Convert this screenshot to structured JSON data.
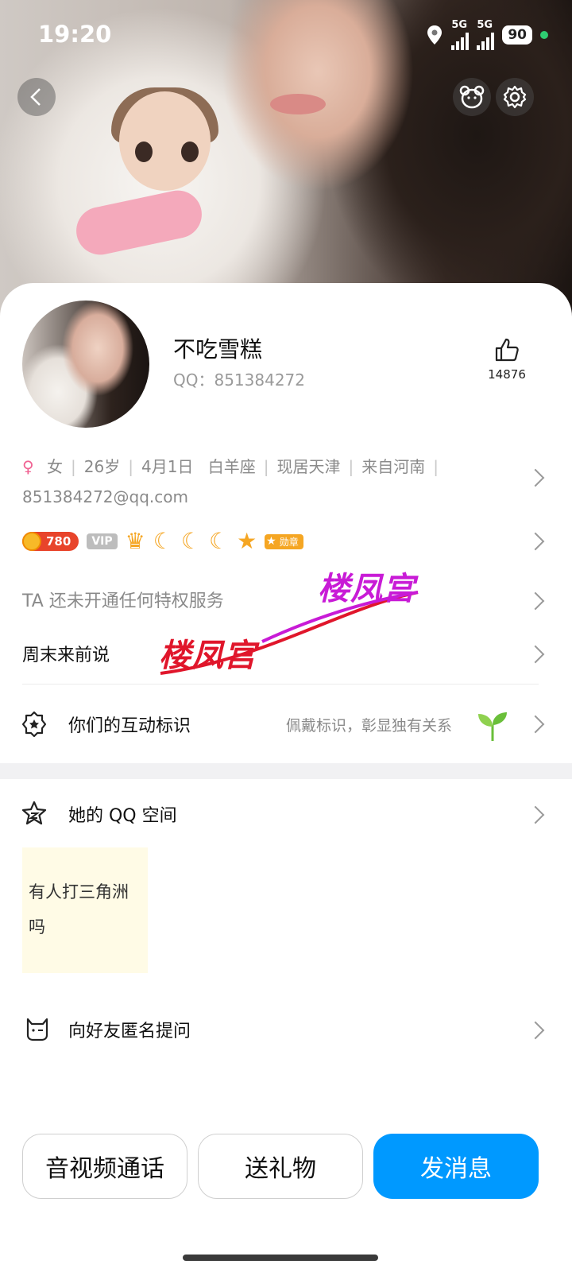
{
  "status_bar": {
    "time": "19:20",
    "network_1": "5G",
    "network_2": "5G",
    "battery": "90"
  },
  "profile": {
    "nickname": "不吃雪糕",
    "qq": "QQ：851384272",
    "like_count": "14876"
  },
  "info": {
    "gender_symbol": "♀",
    "gender": "女",
    "age": "26岁",
    "birthday": "4月1日",
    "zodiac": "白羊座",
    "location": "现居天津",
    "hometown": "来自河南",
    "email": "851384272@qq.com"
  },
  "badges": {
    "coin_level": "780",
    "vip": "VIP",
    "medal": "勋章"
  },
  "privilege": "TA 还未开通任何特权服务",
  "signature": "周末来前说",
  "watermark": {
    "text_1": "楼凤宫",
    "text_2": "楼凤宫"
  },
  "interaction": {
    "label": "你们的互动标识",
    "hint": "佩戴标识，彰显独有关系"
  },
  "qzone": {
    "label": "她的 QQ 空间",
    "note_line_1": "有人打三角洲",
    "note_line_2": "吗"
  },
  "anonymous": {
    "label": "向好友匿名提问"
  },
  "actions": {
    "call": "音视频通话",
    "gift": "送礼物",
    "message": "发消息"
  },
  "colors": {
    "primary": "#0099ff",
    "watermark_red": "#e0162b",
    "watermark_purple": "#c81bd6"
  }
}
